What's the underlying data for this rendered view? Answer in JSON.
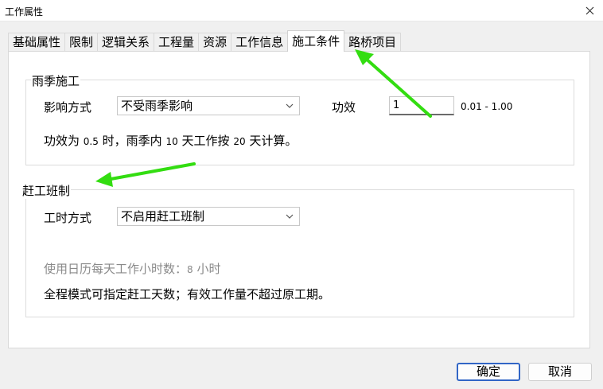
{
  "window": {
    "title": "工作属性"
  },
  "tabs": [
    {
      "label": "基础属性"
    },
    {
      "label": "限制"
    },
    {
      "label": "逻辑关系"
    },
    {
      "label": "工程量"
    },
    {
      "label": "资源"
    },
    {
      "label": "工作信息"
    },
    {
      "label": "施工条件",
      "active": true
    },
    {
      "label": "路桥项目"
    }
  ],
  "rain": {
    "title": "雨季施工",
    "mode_label": "影响方式",
    "mode_value": "不受雨季影响",
    "efficiency_label": "功效",
    "efficiency_value": "1",
    "range": "0.01 - 1.00",
    "desc_a": "功效为",
    "desc_n1": "0.5",
    "desc_b": "时，雨季内",
    "desc_n2": "10",
    "desc_c": "天工作按",
    "desc_n3": "20",
    "desc_d": "天计算。"
  },
  "rush": {
    "title": "赶工班制",
    "mode_label": "工时方式",
    "mode_value": "不启用赶工班制",
    "hours_a": "使用日历每天工作小时数：",
    "hours_n": "8",
    "hours_b": "小时",
    "note": "全程模式可指定赶工天数；有效工作量不超过原工期。"
  },
  "buttons": {
    "ok": "确定",
    "cancel": "取消"
  },
  "colors": {
    "arrow": "#33dd11",
    "primary_border": "#3266c6"
  }
}
